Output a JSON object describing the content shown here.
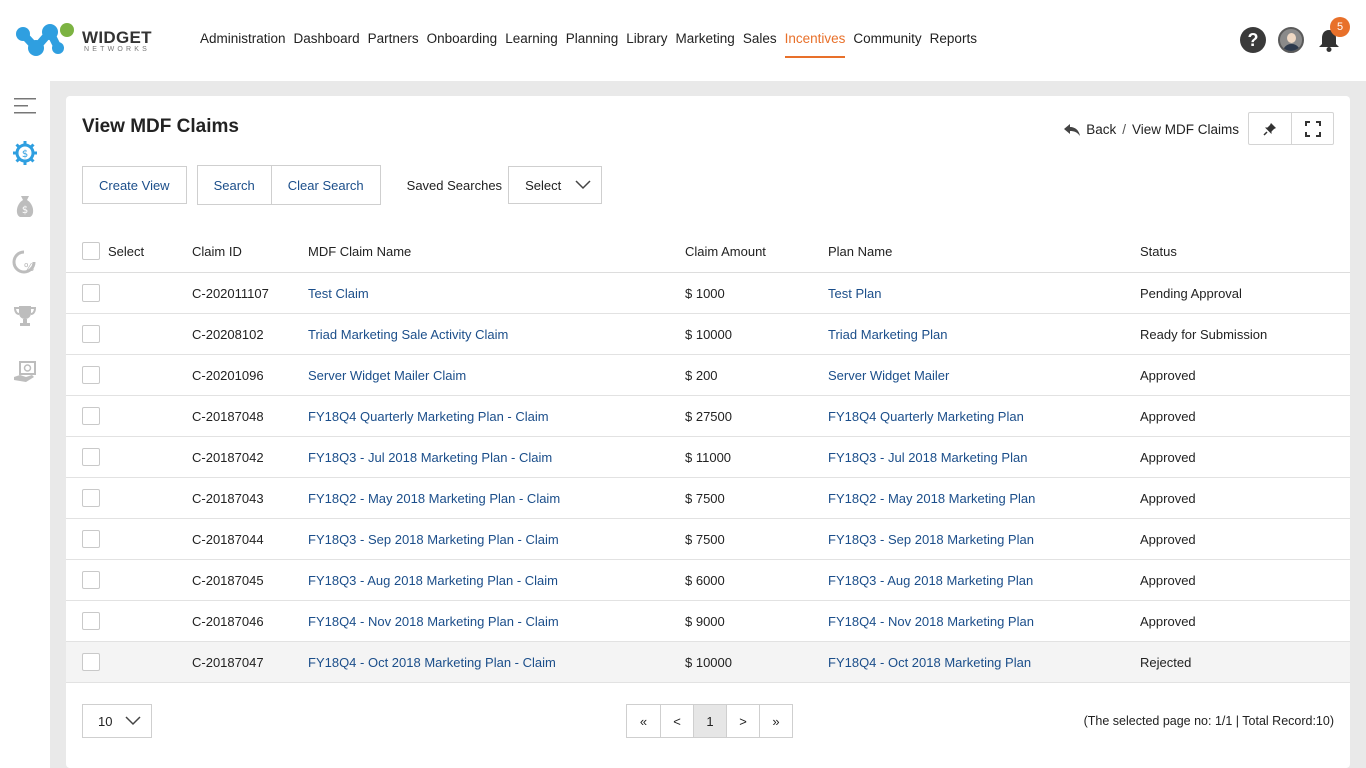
{
  "brand": {
    "name": "WIDGET",
    "tagline": "NETWORKS",
    "colors": {
      "blue": "#2f9fe0",
      "green": "#7cb342",
      "accent": "#e8702a"
    }
  },
  "nav": [
    {
      "label": "Administration"
    },
    {
      "label": "Dashboard"
    },
    {
      "label": "Partners"
    },
    {
      "label": "Onboarding"
    },
    {
      "label": "Learning"
    },
    {
      "label": "Planning"
    },
    {
      "label": "Library"
    },
    {
      "label": "Marketing"
    },
    {
      "label": "Sales"
    },
    {
      "label": "Incentives",
      "active": true
    },
    {
      "label": "Community"
    },
    {
      "label": "Reports"
    }
  ],
  "header": {
    "notification_count": "5"
  },
  "page": {
    "title": "View MDF Claims",
    "breadcrumb": {
      "back": "Back",
      "separator": "/",
      "current": "View MDF Claims"
    }
  },
  "actions": {
    "create_view": "Create View",
    "search": "Search",
    "clear_search": "Clear Search",
    "saved_searches_label": "Saved Searches",
    "saved_searches_value": "Select"
  },
  "table": {
    "headers": {
      "select": "Select",
      "claim_id": "Claim ID",
      "claim_name": "MDF Claim Name",
      "amount": "Claim Amount",
      "plan": "Plan Name",
      "status": "Status"
    },
    "rows": [
      {
        "id": "C-202011107",
        "name": "Test Claim",
        "amount": "$ 1000",
        "plan": "Test Plan",
        "status": "Pending Approval"
      },
      {
        "id": "C-20208102",
        "name": "Triad Marketing Sale Activity Claim",
        "amount": "$ 10000",
        "plan": "Triad Marketing Plan",
        "status": "Ready for Submission"
      },
      {
        "id": "C-20201096",
        "name": "Server Widget Mailer Claim",
        "amount": "$ 200",
        "plan": "Server Widget Mailer",
        "status": "Approved"
      },
      {
        "id": "C-20187048",
        "name": "FY18Q4 Quarterly Marketing Plan - Claim",
        "amount": "$ 27500",
        "plan": "FY18Q4 Quarterly Marketing Plan",
        "status": "Approved"
      },
      {
        "id": "C-20187042",
        "name": "FY18Q3 - Jul 2018 Marketing Plan - Claim",
        "amount": "$ 11000",
        "plan": "FY18Q3 - Jul 2018 Marketing Plan",
        "status": "Approved"
      },
      {
        "id": "C-20187043",
        "name": "FY18Q2 - May 2018 Marketing Plan - Claim",
        "amount": "$ 7500",
        "plan": "FY18Q2 - May 2018 Marketing Plan",
        "status": "Approved"
      },
      {
        "id": "C-20187044",
        "name": "FY18Q3 - Sep 2018 Marketing Plan - Claim",
        "amount": "$ 7500",
        "plan": "FY18Q3 - Sep 2018 Marketing Plan",
        "status": "Approved"
      },
      {
        "id": "C-20187045",
        "name": "FY18Q3 - Aug 2018 Marketing Plan - Claim",
        "amount": "$ 6000",
        "plan": "FY18Q3 - Aug 2018 Marketing Plan",
        "status": "Approved"
      },
      {
        "id": "C-20187046",
        "name": "FY18Q4 - Nov 2018 Marketing Plan - Claim",
        "amount": "$ 9000",
        "plan": "FY18Q4 - Nov 2018 Marketing Plan",
        "status": "Approved"
      },
      {
        "id": "C-20187047",
        "name": "FY18Q4 - Oct 2018 Marketing Plan - Claim",
        "amount": "$ 10000",
        "plan": "FY18Q4 - Oct 2018 Marketing Plan",
        "status": "Rejected"
      }
    ]
  },
  "footer": {
    "page_size": "10",
    "pager": {
      "first": "«",
      "prev": "<",
      "current": "1",
      "next": ">",
      "last": "»"
    },
    "record_info": "(The selected page no: 1/1 | Total Record:10)"
  }
}
